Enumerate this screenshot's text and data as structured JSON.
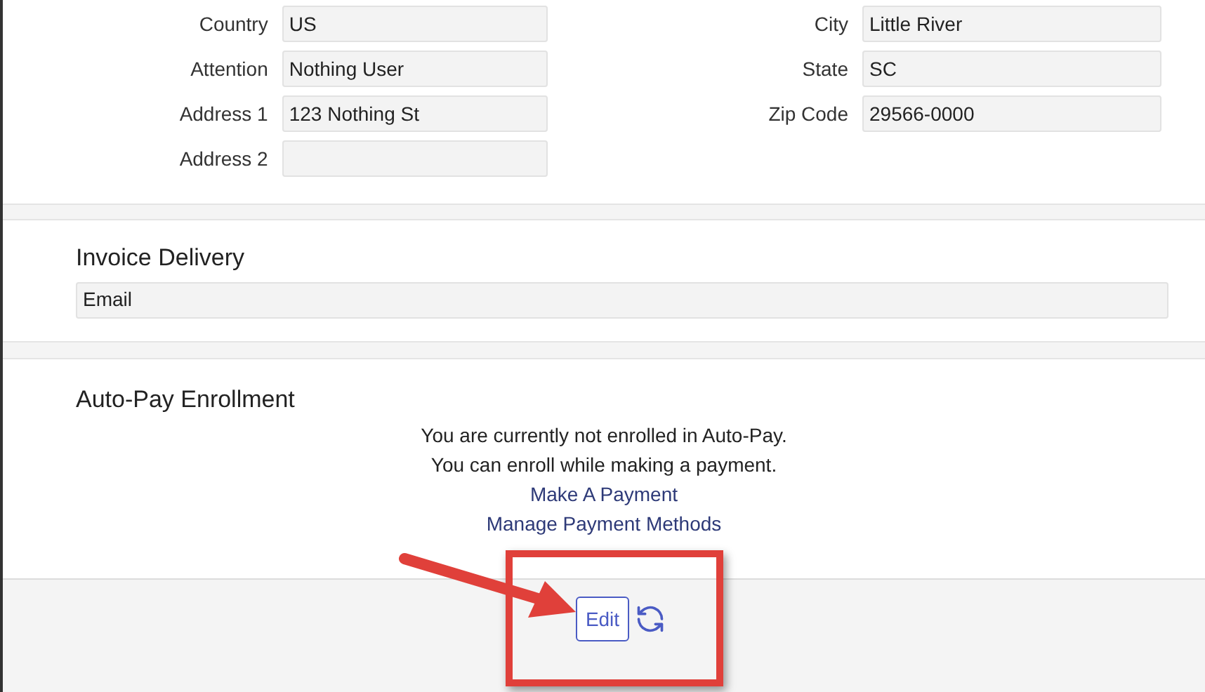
{
  "address_fields": [
    {
      "label": "Country",
      "value": "US"
    },
    {
      "label": "City",
      "value": "Little River"
    },
    {
      "label": "Attention",
      "value": "Nothing User"
    },
    {
      "label": "State",
      "value": "SC"
    },
    {
      "label": "Address 1",
      "value": "123 Nothing St"
    },
    {
      "label": "Zip Code",
      "value": "29566-0000"
    },
    {
      "label": "Address 2"
    }
  ],
  "invoice_delivery": {
    "title": "Invoice Delivery",
    "value": "Email"
  },
  "auto_pay": {
    "title": "Auto-Pay Enrollment",
    "messages": [
      "You are currently not enrolled in Auto-Pay.",
      "You can enroll while making a payment."
    ],
    "links": [
      "Make A Payment",
      "Manage Payment Methods"
    ]
  },
  "footer": {
    "edit_button": "Edit"
  }
}
